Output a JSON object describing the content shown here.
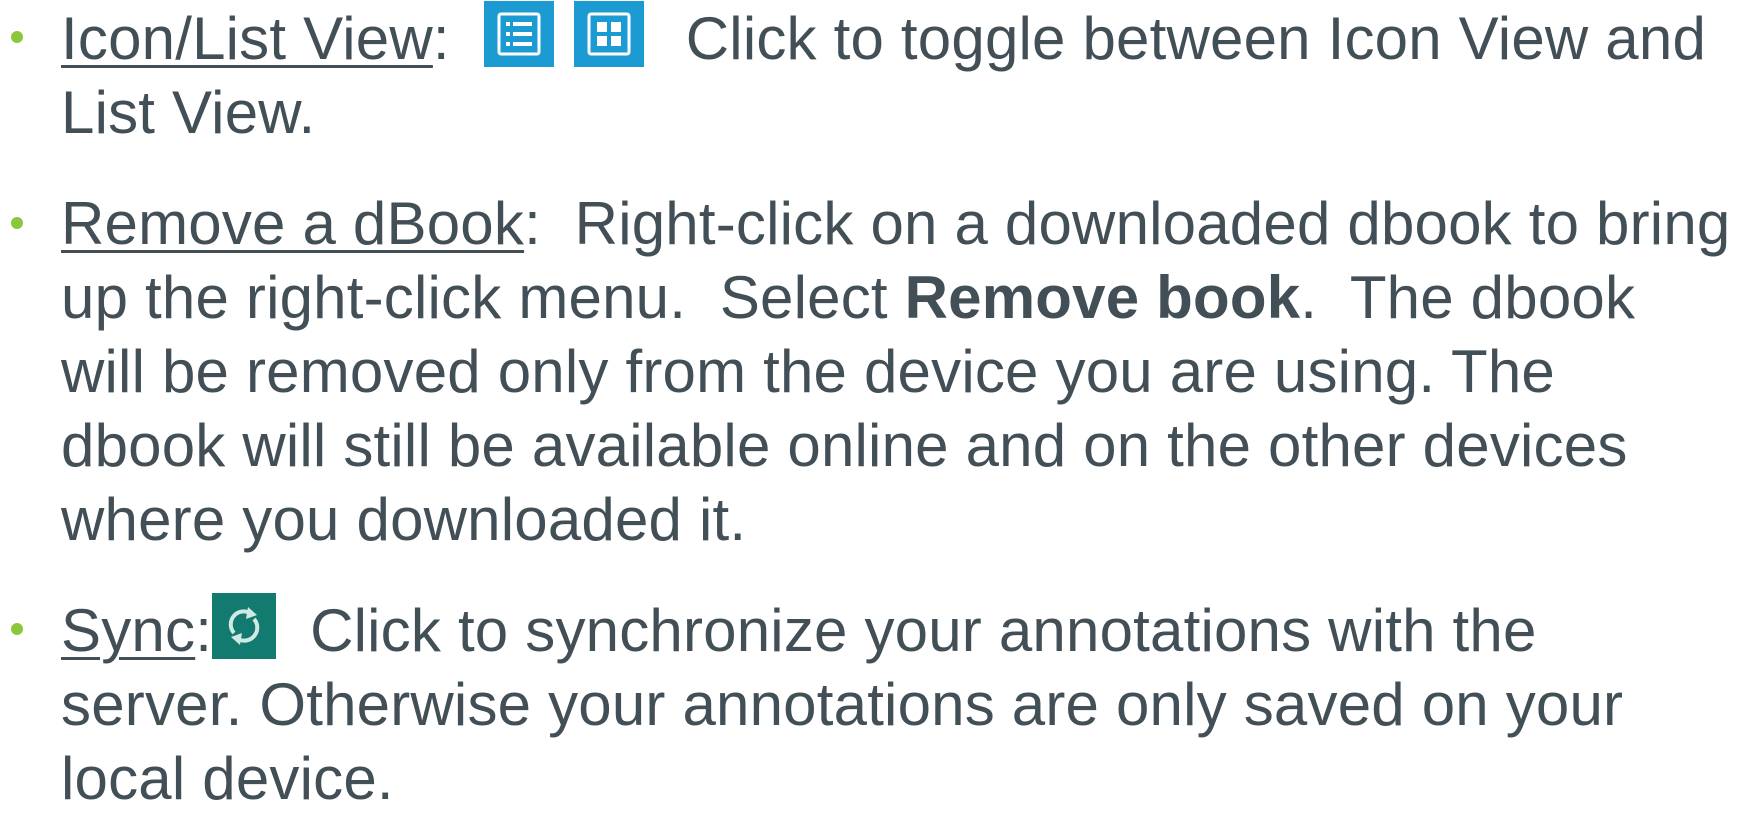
{
  "colors": {
    "text": "#434f56",
    "bullet": "#8cc63f",
    "view_icon_bg": "#1b9bd1",
    "sync_icon_bg": "#127a6f",
    "icon_glyph": "#ffffff"
  },
  "bullets": [
    {
      "term": "Icon/List View",
      "sep": ":",
      "icons": [
        "list-view-icon",
        "icon-view-icon"
      ],
      "text": "Click to toggle between Icon View and List View."
    },
    {
      "term": "Remove a dBook",
      "sep": ":",
      "text_before": "  Right-click on a downloaded dbook to bring up the right-click menu.  Select ",
      "strong": "Remove book",
      "text_after": ".  The dbook will be removed only from the device you are using. The dbook will still be available online and on the other devices where you downloaded it."
    },
    {
      "term": "Sync",
      "sep": ":",
      "icons": [
        "sync-icon"
      ],
      "text": "Click to synchronize your annotations with the server.  Otherwise your annotations are only saved on your local device."
    }
  ]
}
